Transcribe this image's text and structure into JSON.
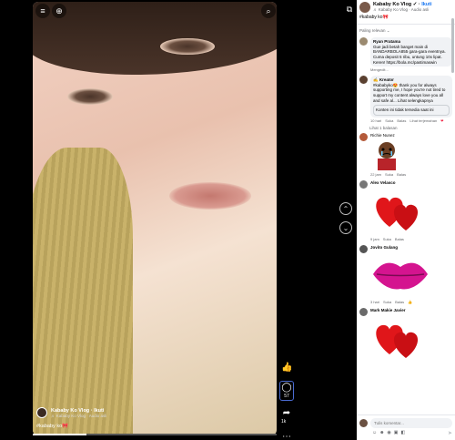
{
  "post": {
    "author": "Kababy Ko Vlog",
    "verified_mark": "✓",
    "follow": "Ikuti",
    "subtitle": "♬ Kababy Ko Vlog · Audio asli",
    "caption": "#kababy ko🎀"
  },
  "video": {
    "author": "Kababy Ko Vlog",
    "follow": "Ikuti",
    "audio": "♬ Kababy Ko Vlog · Audio asli",
    "caption": "#kababy ko🎀",
    "comment_count": "57",
    "share_count": "1k"
  },
  "comments": {
    "filter": "Paling relevan ⌄",
    "items": [
      {
        "name": "Ryan Pratama",
        "text": "Gue jadi betah banget main di BANDARBOLA855 gara-gara eventnya. Cuma deposit 5 ribu, untung 10x lipat. Keren! https://bola.mc/pastimaswin",
        "time": "Mengedit..."
      },
      {
        "name": "✍ Kreator",
        "text": "#kababyko😍 thank you for always supporting me, I hope you're not tired to support my content always love you all and safe al... Lihat selengkapnya",
        "nested": "Konten ini tidak tersedia saat ini",
        "time": "10 hari",
        "actions": [
          "Suka",
          "Balas",
          "Lihat terjemahan"
        ]
      },
      {
        "name": "Richie Nunez",
        "time": "22 jam",
        "actions": [
          "Suka",
          "Balas"
        ]
      },
      {
        "name": "Alex Velasco",
        "time": "9 jam",
        "actions": [
          "Suka",
          "Balas"
        ]
      },
      {
        "name": "Jovito Gulang",
        "time": "3 hari",
        "actions": [
          "Suka",
          "Balas"
        ]
      },
      {
        "name": "Mark Makie Javier"
      }
    ],
    "view_reply": "Lihat 1 balasan"
  },
  "composer": {
    "placeholder": "Tulis komentar..."
  },
  "colors": {
    "accent": "#1877f2",
    "bubble": "#f0f2f5",
    "like": "#f02849"
  }
}
